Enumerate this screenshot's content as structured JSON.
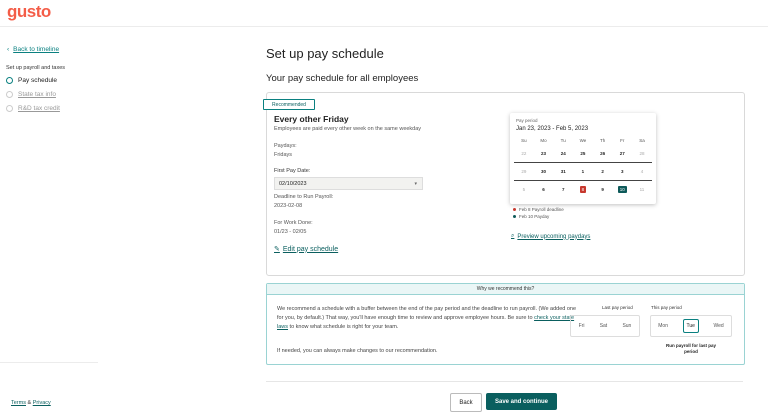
{
  "app": {
    "logo": "gusto"
  },
  "sidebar": {
    "back_link": "Back to timeline",
    "section_heading": "Set up payroll and taxes",
    "steps": [
      {
        "label": "Pay schedule",
        "state": "current"
      },
      {
        "label": "State tax info",
        "state": "upcoming"
      },
      {
        "label": "R&D tax credit",
        "state": "upcoming"
      }
    ],
    "footer": {
      "terms": "Terms",
      "amp": "&",
      "privacy": "Privacy"
    }
  },
  "main": {
    "title": "Set up pay schedule",
    "subtitle": "Your pay schedule for all employees",
    "schedule_card": {
      "badge": "Recommended",
      "name": "Every other Friday",
      "description": "Employees are paid every other week on the same weekday",
      "paydays_label": "Paydays:",
      "paydays_value": "Fridays",
      "first_pay_date_label": "First Pay Date:",
      "first_pay_date_value": "02/10/2023",
      "deadline_label": "Deadline to Run Payroll:",
      "deadline_value": "2023-02-08",
      "work_done_label": "For Work Done:",
      "work_done_value": "01/23 - 02/05",
      "edit_link": "Edit pay schedule",
      "preview_link": "Preview upcoming paydays"
    },
    "calendar": {
      "label": "Pay period",
      "range": "Jan 23, 2023 - Feb 5, 2023",
      "weekdays": [
        "Su",
        "Mo",
        "Tu",
        "We",
        "Th",
        "Fr",
        "Sa"
      ],
      "weeks": [
        [
          "22",
          "23",
          "24",
          "25",
          "26",
          "27",
          "28"
        ],
        [
          "29",
          "30",
          "31",
          "1",
          "2",
          "3",
          "4"
        ],
        [
          "5",
          "6",
          "7",
          "8",
          "9",
          "10",
          "11"
        ]
      ],
      "legend": [
        {
          "text": "Feb 8 Payroll deadline",
          "color": "#c7382e"
        },
        {
          "text": "Feb 10 Payday",
          "color": "#0e5a5a"
        }
      ]
    },
    "why": {
      "heading": "Why we recommend this?",
      "text_before_link": "We recommend a schedule with a buffer between the end of the pay period and the deadline to run payroll. (We added one for you, by default.) That way, you'll have enough time to review and approve employee hours. Be sure to ",
      "link": "check your state laws",
      "text_after_link": " to know what schedule is right for your team.",
      "note": "If needed, you can always make changes to our recommendation.",
      "last_period_label": "Last pay period",
      "last_period_days": [
        "Fri",
        "Sat",
        "Sun"
      ],
      "this_period_label": "This pay period",
      "this_period_days": [
        "Mon",
        "Tue",
        "Wed"
      ],
      "run_note": "Run payroll for last pay period"
    },
    "buttons": {
      "back": "Back",
      "save": "Save and continue"
    }
  }
}
